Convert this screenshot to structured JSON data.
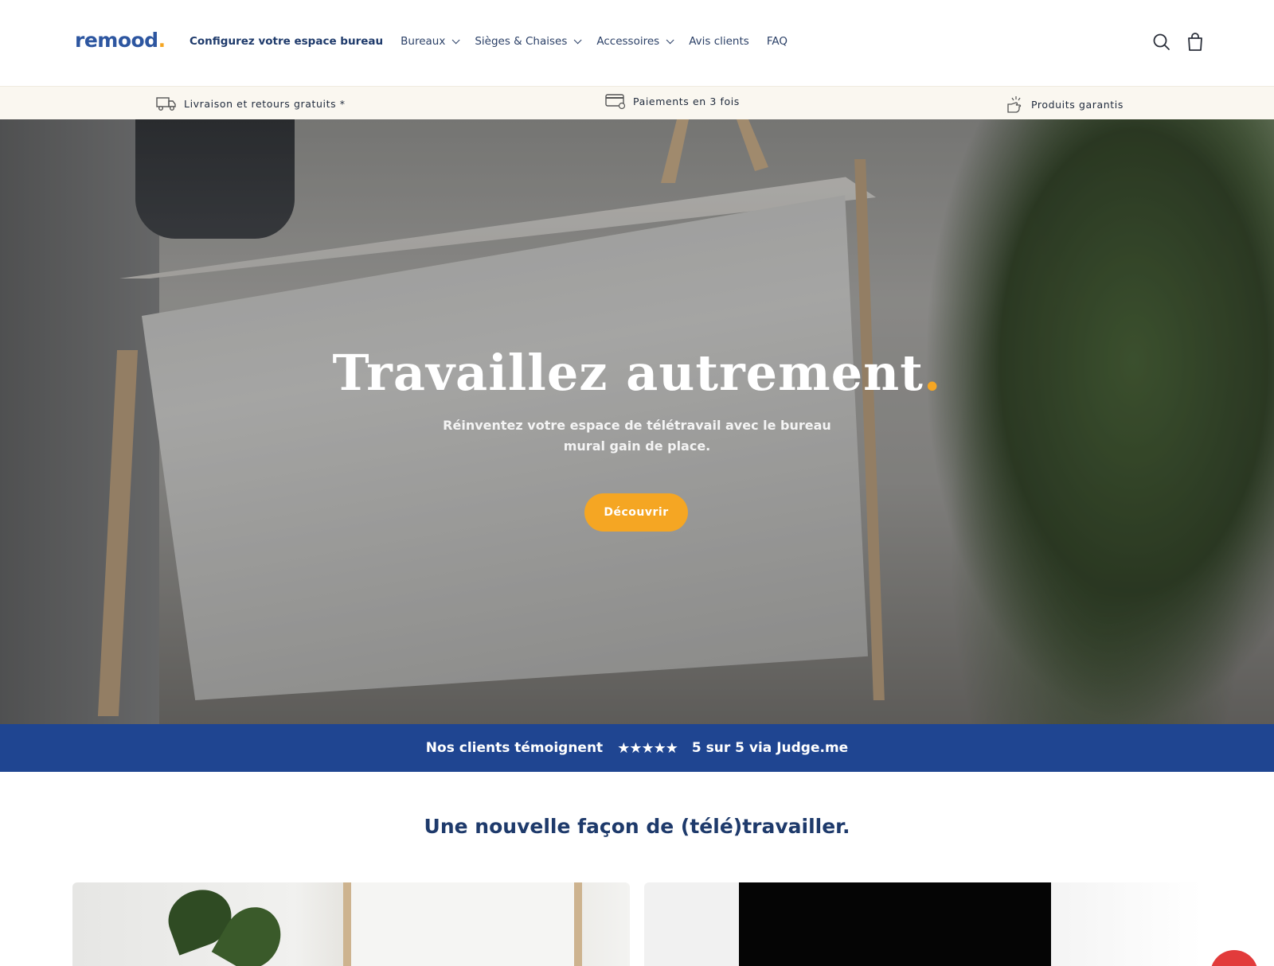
{
  "brand": {
    "name": "remood",
    "dot": "."
  },
  "nav": {
    "primary": "Configurez votre espace bureau",
    "items": [
      {
        "label": "Bureaux",
        "dropdown": true
      },
      {
        "label": "Sièges & Chaises",
        "dropdown": true
      },
      {
        "label": "Accessoires",
        "dropdown": true
      },
      {
        "label": "Avis clients",
        "dropdown": false
      },
      {
        "label": "FAQ",
        "dropdown": false
      }
    ],
    "icons": [
      "search-icon",
      "cart-icon"
    ]
  },
  "usp": [
    {
      "label": "Livraison et retours gratuits *",
      "icon": "truck-icon"
    },
    {
      "label": "Paiements en 3 fois",
      "icon": "card-icon"
    },
    {
      "label": "Produits garantis",
      "icon": "hand-sparkle-icon"
    }
  ],
  "hero": {
    "title": "Travaillez autrement",
    "title_accent": ".",
    "subtitle": "Réinventez votre espace de télétravail avec le bureau mural gain de place.",
    "cta": "Découvrir"
  },
  "reviews": {
    "label": "Nos clients témoignent",
    "stars": "★★★★★",
    "rating": 5,
    "summary": "5 sur 5 via Judge.me"
  },
  "section": {
    "title": "Une nouvelle façon de (télé)travailler."
  },
  "colors": {
    "brand_blue": "#1f4591",
    "accent": "#f5a623",
    "text_navy": "#1e3a6b",
    "usp_bg": "#faf7f0"
  }
}
